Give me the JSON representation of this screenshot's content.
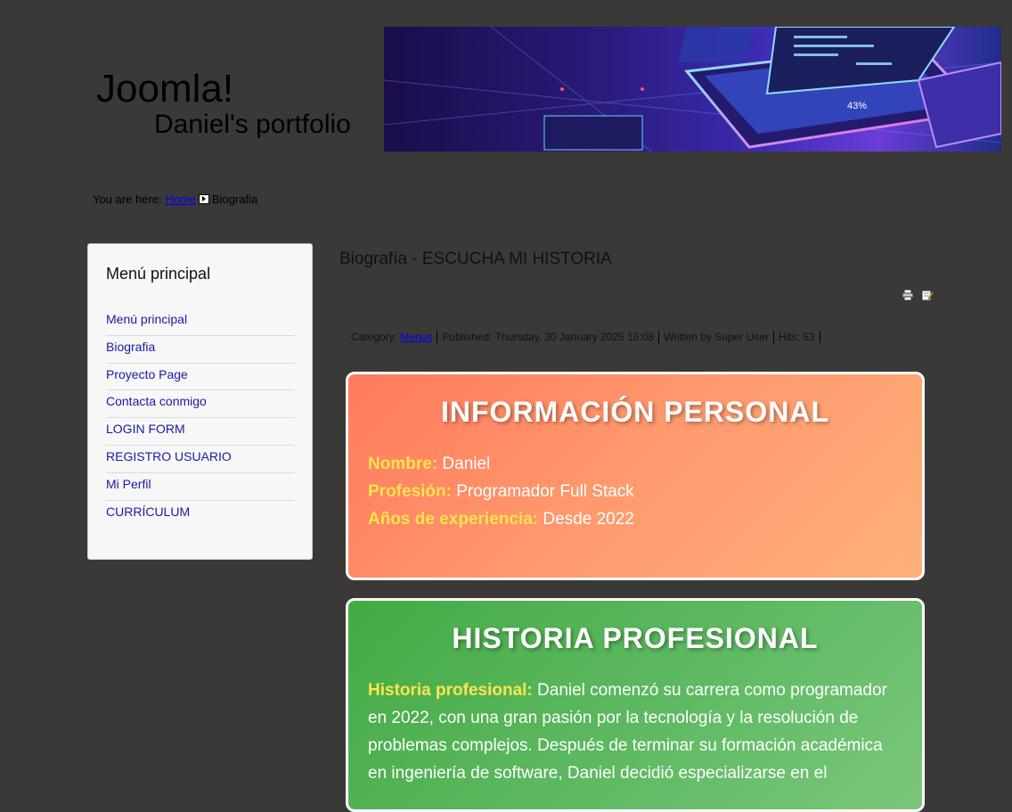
{
  "header": {
    "logo_title": "Joomla!",
    "logo_subtitle": "Daniel's portfolio"
  },
  "breadcrumb": {
    "prefix": "You are here:",
    "home": "Home",
    "current": "Biografia"
  },
  "sidebar": {
    "title": "Menú principal",
    "items": [
      {
        "label": "Menú principal"
      },
      {
        "label": "Biografia"
      },
      {
        "label": "Proyecto Page"
      },
      {
        "label": "Contacta conmigo"
      },
      {
        "label": "LOGIN FORM"
      },
      {
        "label": "REGISTRO USUARIO"
      },
      {
        "label": "Mi Perfil"
      },
      {
        "label": "CURRÍCULUM"
      }
    ]
  },
  "article": {
    "title": "Biografía - ESCUCHA MI HISTORIA",
    "meta": {
      "category_prefix": "Category:",
      "category": "Menus",
      "published": "Published: Thursday, 30 January 2025 15:08",
      "author": "Written by Super User",
      "hits": "Hits: 53"
    },
    "icons": [
      "print-icon",
      "email-icon"
    ]
  },
  "personal": {
    "heading": "INFORMACIÓN PERSONAL",
    "name_label": "Nombre:",
    "name_value": "Daniel",
    "profession_label": "Profesión:",
    "profession_value": "Programador Full Stack",
    "experience_label": "Años de experiencia:",
    "experience_value": "Desde 2022"
  },
  "history": {
    "heading": "HISTORIA PROFESIONAL",
    "label": "Historia profesional:",
    "text": "Daniel comenzó su carrera como programador en 2022, con una gran pasión por la tecnología y la resolución de problemas complejos. Después de terminar su formación académica en ingeniería de software, Daniel decidió especializarse en el"
  },
  "colors": {
    "page_bg": "#3a3937",
    "personal_card": "#ff8a65",
    "history_card": "#55b255",
    "label_yellow": "#ffe44d",
    "link": "#1a1aa8"
  }
}
